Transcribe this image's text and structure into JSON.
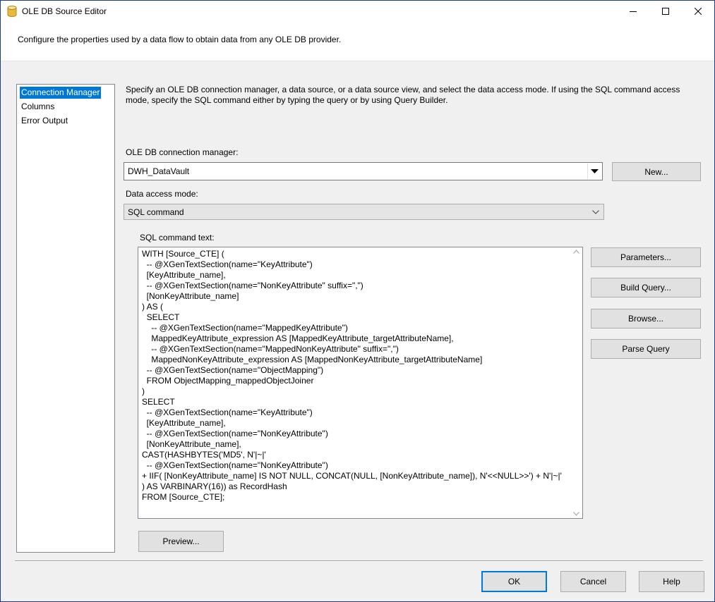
{
  "window": {
    "title": "OLE DB Source Editor",
    "description": "Configure the properties used by a data flow to obtain data from any OLE DB provider."
  },
  "nav": {
    "items": [
      {
        "label": "Connection Manager",
        "selected": true
      },
      {
        "label": "Columns",
        "selected": false
      },
      {
        "label": "Error Output",
        "selected": false
      }
    ]
  },
  "main": {
    "help_text": "Specify an OLE DB connection manager, a data source, or a data source view, and select the data access mode. If using the SQL command access mode, specify the SQL command either by typing the query or by using Query Builder.",
    "connection_label": "OLE DB connection manager:",
    "connection_value": "DWH_DataVault",
    "new_button": "New...",
    "access_mode_label": "Data access mode:",
    "access_mode_value": "SQL command",
    "sql_label": "SQL command text:",
    "sql_text": "WITH [Source_CTE] (\n  -- @XGenTextSection(name=\"KeyAttribute\")\n  [KeyAttribute_name],\n  -- @XGenTextSection(name=\"NonKeyAttribute\" suffix=\",\")\n  [NonKeyAttribute_name]\n) AS (\n  SELECT\n    -- @XGenTextSection(name=\"MappedKeyAttribute\")\n    MappedKeyAttribute_expression AS [MappedKeyAttribute_targetAttributeName],\n    -- @XGenTextSection(name=\"MappedNonKeyAttribute\" suffix=\",\")\n    MappedNonKeyAttribute_expression AS [MappedNonKeyAttribute_targetAttributeName]\n  -- @XGenTextSection(name=\"ObjectMapping\")\n  FROM ObjectMapping_mappedObjectJoiner\n)\nSELECT\n  -- @XGenTextSection(name=\"KeyAttribute\")\n  [KeyAttribute_name],\n  -- @XGenTextSection(name=\"NonKeyAttribute\")\n  [NonKeyAttribute_name],\nCAST(HASHBYTES('MD5', N'|~|'\n  -- @XGenTextSection(name=\"NonKeyAttribute\")\n+ IIF( [NonKeyAttribute_name] IS NOT NULL, CONCAT(NULL, [NonKeyAttribute_name]), N'<<NULL>>') + N'|~|'\n) AS VARBINARY(16)) as RecordHash\nFROM [Source_CTE];",
    "buttons": {
      "parameters": "Parameters...",
      "build_query": "Build Query...",
      "browse": "Browse...",
      "parse_query": "Parse Query",
      "preview": "Preview..."
    }
  },
  "footer": {
    "ok": "OK",
    "cancel": "Cancel",
    "help": "Help"
  },
  "colors": {
    "selection": "#0078d7",
    "title_border": "#1e3c8c"
  }
}
